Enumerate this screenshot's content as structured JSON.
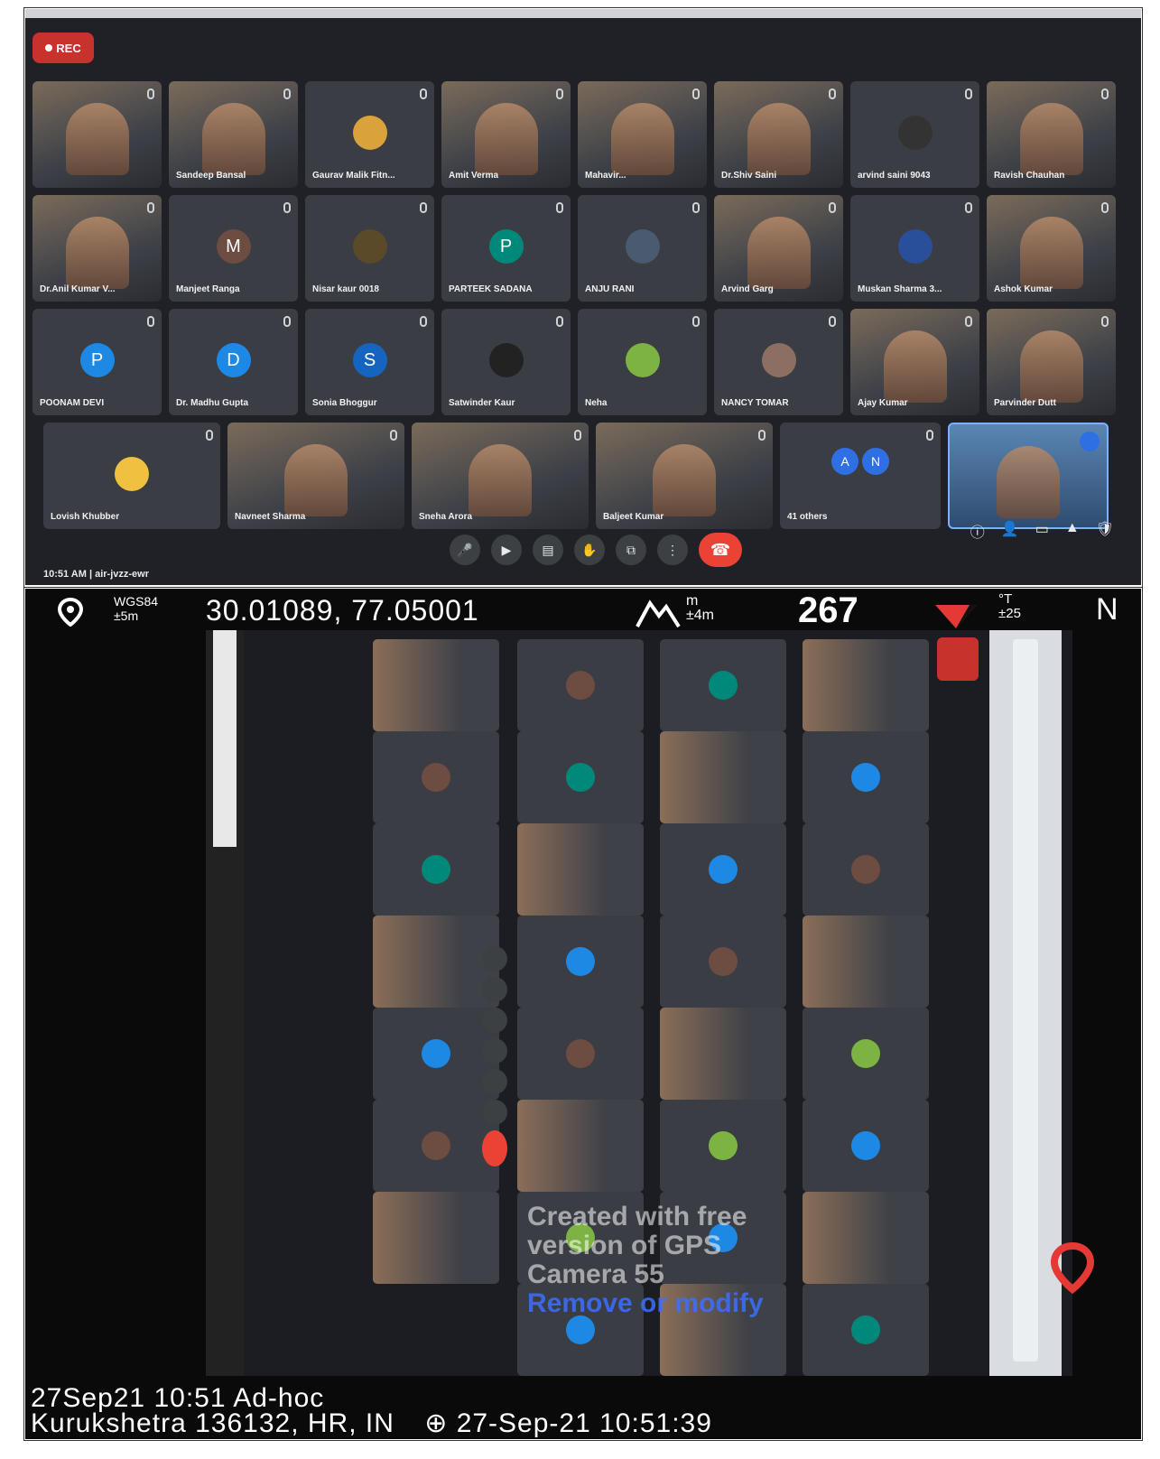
{
  "meet": {
    "rec_label": "REC",
    "rows": [
      [
        {
          "name": "",
          "kind": "video"
        },
        {
          "name": "Sandeep Bansal",
          "kind": "video"
        },
        {
          "name": "Gaurav Malik Fitn...",
          "kind": "photo",
          "color": "#d9a23a"
        },
        {
          "name": "Amit Verma",
          "kind": "video"
        },
        {
          "name": "Mahavir...",
          "kind": "video"
        },
        {
          "name": "Dr.Shiv Saini",
          "kind": "video"
        },
        {
          "name": "arvind saini 9043",
          "kind": "photo",
          "color": "#333"
        },
        {
          "name": "Ravish Chauhan",
          "kind": "video"
        }
      ],
      [
        {
          "name": "Dr.Anil Kumar V...",
          "kind": "video"
        },
        {
          "name": "Manjeet Ranga",
          "kind": "letter",
          "letter": "M",
          "color": "#6d4c41"
        },
        {
          "name": "Nisar kaur 0018",
          "kind": "photo",
          "color": "#5a4a2a"
        },
        {
          "name": "PARTEEK SADANA",
          "kind": "letter",
          "letter": "P",
          "color": "#00897b"
        },
        {
          "name": "ANJU RANI",
          "kind": "photo",
          "color": "#4a5a70"
        },
        {
          "name": "Arvind Garg",
          "kind": "video"
        },
        {
          "name": "Muskan Sharma 3...",
          "kind": "photo",
          "color": "#2a4f9a"
        },
        {
          "name": "Ashok Kumar",
          "kind": "video"
        }
      ],
      [
        {
          "name": "POONAM DEVI",
          "kind": "letter",
          "letter": "P",
          "color": "#1e88e5"
        },
        {
          "name": "Dr. Madhu Gupta",
          "kind": "letter",
          "letter": "D",
          "color": "#1e88e5"
        },
        {
          "name": "Sonia Bhoggur",
          "kind": "letter",
          "letter": "S",
          "color": "#1565c0"
        },
        {
          "name": "Satwinder Kaur",
          "kind": "photo",
          "color": "#222"
        },
        {
          "name": "Neha",
          "kind": "photo",
          "color": "#7cb342"
        },
        {
          "name": "NANCY TOMAR",
          "kind": "photo",
          "color": "#8d6e63"
        },
        {
          "name": "Ajay Kumar",
          "kind": "video"
        },
        {
          "name": "Parvinder Dutt",
          "kind": "video"
        }
      ],
      [
        {
          "name": "Lovish Khubber",
          "kind": "photo",
          "color": "#f0c040"
        },
        {
          "name": "Navneet Sharma",
          "kind": "video"
        },
        {
          "name": "Sneha Arora",
          "kind": "video"
        },
        {
          "name": "Baljeet Kumar",
          "kind": "video"
        },
        {
          "name": "41 others",
          "kind": "others",
          "letters": [
            "A",
            "N"
          ]
        },
        {
          "name": "",
          "kind": "self"
        }
      ]
    ],
    "clock_text": "10:51 AM | air-jvzz-ewr"
  },
  "gps": {
    "datum": "WGS84",
    "accuracy": "±5m",
    "coordinates": "30.01089, 77.05001",
    "altitude_unit": "m",
    "altitude_accuracy": "±4m",
    "heading": "267",
    "heading_unit": "°T",
    "heading_accuracy": "±25",
    "direction_letter": "N",
    "watermark_line1": "Created with free",
    "watermark_line2": "version of GPS",
    "watermark_line3": "Camera 55",
    "watermark_line4": "Remove or modify",
    "stamp_line1": "27Sep21 10:51  Ad-hoc",
    "stamp_line2": "Kurukshetra 136132, HR, IN",
    "stamp_time": "⊕ 27-Sep-21 10:51:39"
  }
}
